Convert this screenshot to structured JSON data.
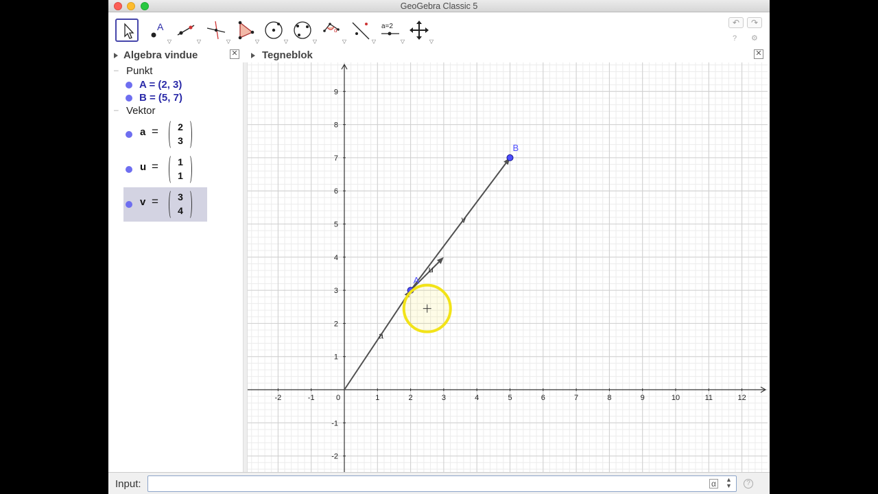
{
  "window": {
    "title": "GeoGebra Classic 5"
  },
  "toolbar": {
    "tools": [
      "move-tool",
      "point-tool",
      "line-tool",
      "perpendicular-line-tool",
      "polygon-tool",
      "circle-tool",
      "conic-tool",
      "angle-tool",
      "reflect-tool",
      "slider-tool",
      "move-graphics-view-tool"
    ],
    "undo_icon": "↶",
    "redo_icon": "↷",
    "help_icon": "?",
    "settings_icon": "⚙",
    "slider_label": "a=2"
  },
  "algebra": {
    "title": "Algebra vindue",
    "groups": [
      {
        "label": "Punkt",
        "items": [
          "A = (2, 3)",
          "B = (5, 7)"
        ]
      },
      {
        "label": "Vektor"
      }
    ],
    "vectors": [
      {
        "name": "a",
        "eq": "=",
        "top": "2",
        "bottom": "3"
      },
      {
        "name": "u",
        "eq": "=",
        "top": "1",
        "bottom": "1"
      },
      {
        "name": "v",
        "eq": "=",
        "top": "3",
        "bottom": "4"
      }
    ]
  },
  "graphics": {
    "title": "Tegneblok",
    "x_ticks": [
      "-2",
      "-1",
      "0",
      "1",
      "2",
      "3",
      "4",
      "5",
      "6",
      "7",
      "8",
      "9",
      "10",
      "11",
      "12"
    ],
    "y_ticks": [
      "9",
      "8",
      "7",
      "6",
      "5",
      "4",
      "3",
      "2",
      "1",
      "-1",
      "-2"
    ],
    "points": [
      {
        "label": "A",
        "x": 2,
        "y": 3
      },
      {
        "label": "B",
        "x": 5,
        "y": 7
      }
    ],
    "vectors": [
      {
        "label": "a",
        "from": [
          0,
          0
        ],
        "to": [
          2,
          3
        ]
      },
      {
        "label": "u",
        "from": [
          2,
          3
        ],
        "to": [
          3,
          4
        ]
      },
      {
        "label": "v",
        "from": [
          2,
          3
        ],
        "to": [
          5,
          7
        ]
      }
    ],
    "colors": {
      "point": "#4d4dff",
      "vector": "#505050",
      "highlight": "#f2e318"
    }
  },
  "input": {
    "label": "Input:",
    "value": "",
    "alpha_icon": "α",
    "help_icon": "?"
  }
}
